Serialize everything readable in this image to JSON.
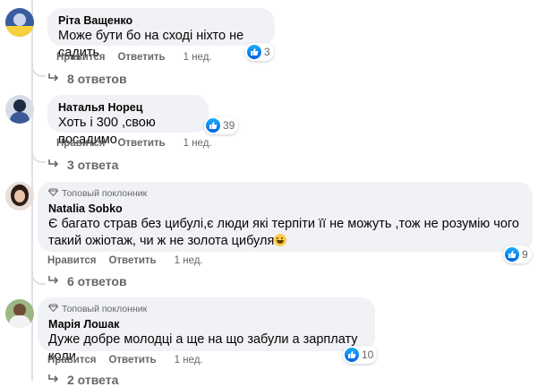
{
  "ui": {
    "like_label": "Нравится",
    "reply_label": "Ответить",
    "top_fan_label": "Топовый поклонник"
  },
  "comments": [
    {
      "author": "Ріта Ващенко",
      "text": "Може бути бо на сході ніхто не садить",
      "time": "1 нед.",
      "reactions": "3",
      "replies": "8 ответов"
    },
    {
      "author": "Наталья Норец",
      "text": "Хоть і 300 ,свою посадимо.",
      "time": "1 нед.",
      "reactions": "39",
      "replies": "3 ответа"
    },
    {
      "author": "Natalia Sobko",
      "line1": "Є багато страв без цибулі,є люди які терпіти її не можуть ,тож не розумію чого",
      "line2": "такий ожіотаж, чи ж не золота цибуля",
      "time": "1 нед.",
      "reactions": "9",
      "replies": "6 ответов"
    },
    {
      "author": "Марія Лошак",
      "text": "Дуже добре молодці а ще на що забули а зарплату коли",
      "time": "1 нед.",
      "reactions": "10",
      "replies": "2 ответа"
    }
  ],
  "colors": {
    "bubble": "#f0f2f5",
    "meta_text": "#65676b",
    "like_blue": "#1877f2"
  }
}
